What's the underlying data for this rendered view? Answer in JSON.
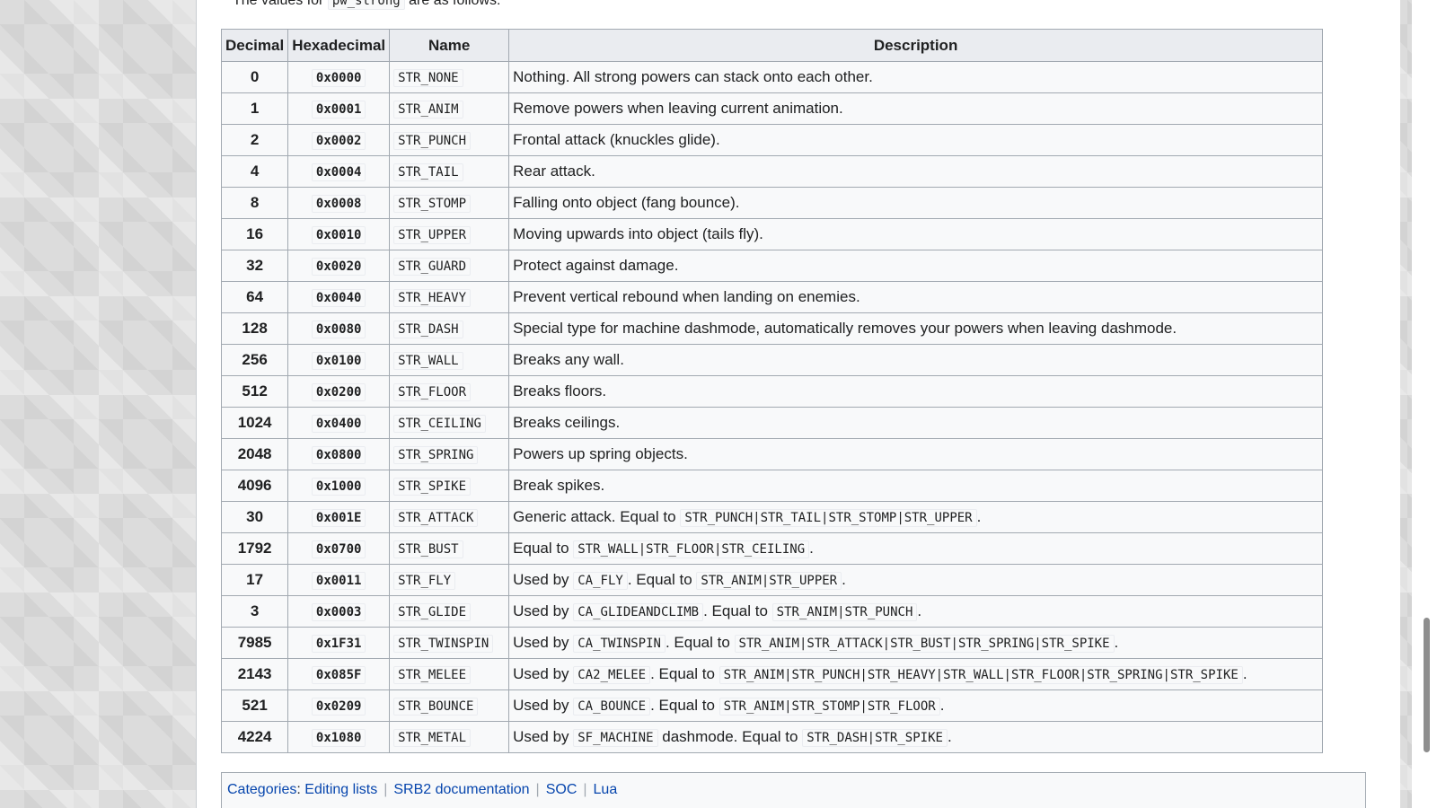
{
  "intro": {
    "before": "The values for ",
    "code": "pw_strong",
    "after": " are as follows:"
  },
  "table": {
    "headers": [
      "Decimal",
      "Hexadecimal",
      "Name",
      "Description"
    ],
    "rows": [
      {
        "dec": "0",
        "hex": "0x0000",
        "name": "STR_NONE",
        "desc": [
          "Nothing. All strong powers can stack onto each other."
        ]
      },
      {
        "dec": "1",
        "hex": "0x0001",
        "name": "STR_ANIM",
        "desc": [
          "Remove powers when leaving current animation."
        ]
      },
      {
        "dec": "2",
        "hex": "0x0002",
        "name": "STR_PUNCH",
        "desc": [
          "Frontal attack (knuckles glide)."
        ]
      },
      {
        "dec": "4",
        "hex": "0x0004",
        "name": "STR_TAIL",
        "desc": [
          "Rear attack."
        ]
      },
      {
        "dec": "8",
        "hex": "0x0008",
        "name": "STR_STOMP",
        "desc": [
          "Falling onto object (fang bounce)."
        ]
      },
      {
        "dec": "16",
        "hex": "0x0010",
        "name": "STR_UPPER",
        "desc": [
          "Moving upwards into object (tails fly)."
        ]
      },
      {
        "dec": "32",
        "hex": "0x0020",
        "name": "STR_GUARD",
        "desc": [
          "Protect against damage."
        ]
      },
      {
        "dec": "64",
        "hex": "0x0040",
        "name": "STR_HEAVY",
        "desc": [
          "Prevent vertical rebound when landing on enemies."
        ]
      },
      {
        "dec": "128",
        "hex": "0x0080",
        "name": "STR_DASH",
        "desc": [
          "Special type for machine dashmode, automatically removes your powers when leaving dashmode."
        ]
      },
      {
        "dec": "256",
        "hex": "0x0100",
        "name": "STR_WALL",
        "desc": [
          "Breaks any wall."
        ]
      },
      {
        "dec": "512",
        "hex": "0x0200",
        "name": "STR_FLOOR",
        "desc": [
          "Breaks floors."
        ]
      },
      {
        "dec": "1024",
        "hex": "0x0400",
        "name": "STR_CEILING",
        "desc": [
          "Breaks ceilings."
        ]
      },
      {
        "dec": "2048",
        "hex": "0x0800",
        "name": "STR_SPRING",
        "desc": [
          "Powers up spring objects."
        ]
      },
      {
        "dec": "4096",
        "hex": "0x1000",
        "name": "STR_SPIKE",
        "desc": [
          "Break spikes."
        ]
      },
      {
        "dec": "30",
        "hex": "0x001E",
        "name": "STR_ATTACK",
        "desc": [
          "Generic attack. Equal to ",
          {
            "code": "STR_PUNCH|STR_TAIL|STR_STOMP|STR_UPPER"
          },
          "."
        ]
      },
      {
        "dec": "1792",
        "hex": "0x0700",
        "name": "STR_BUST",
        "desc": [
          "Equal to ",
          {
            "code": "STR_WALL|STR_FLOOR|STR_CEILING"
          },
          "."
        ]
      },
      {
        "dec": "17",
        "hex": "0x0011",
        "name": "STR_FLY",
        "desc": [
          "Used by ",
          {
            "code": "CA_FLY"
          },
          ". Equal to ",
          {
            "code": "STR_ANIM|STR_UPPER"
          },
          "."
        ]
      },
      {
        "dec": "3",
        "hex": "0x0003",
        "name": "STR_GLIDE",
        "desc": [
          "Used by ",
          {
            "code": "CA_GLIDEANDCLIMB"
          },
          ". Equal to ",
          {
            "code": "STR_ANIM|STR_PUNCH"
          },
          "."
        ]
      },
      {
        "dec": "7985",
        "hex": "0x1F31",
        "name": "STR_TWINSPIN",
        "desc": [
          "Used by ",
          {
            "code": "CA_TWINSPIN"
          },
          ". Equal to ",
          {
            "code": "STR_ANIM|STR_ATTACK|STR_BUST|STR_SPRING|STR_SPIKE"
          },
          "."
        ]
      },
      {
        "dec": "2143",
        "hex": "0x085F",
        "name": "STR_MELEE",
        "desc": [
          "Used by ",
          {
            "code": "CA2_MELEE"
          },
          ". Equal to ",
          {
            "code": "STR_ANIM|STR_PUNCH|STR_HEAVY|STR_WALL|STR_FLOOR|STR_SPRING|STR_SPIKE"
          },
          "."
        ]
      },
      {
        "dec": "521",
        "hex": "0x0209",
        "name": "STR_BOUNCE",
        "desc": [
          "Used by ",
          {
            "code": "CA_BOUNCE"
          },
          ". Equal to ",
          {
            "code": "STR_ANIM|STR_STOMP|STR_FLOOR"
          },
          "."
        ]
      },
      {
        "dec": "4224",
        "hex": "0x1080",
        "name": "STR_METAL",
        "desc": [
          "Used by ",
          {
            "code": "SF_MACHINE"
          },
          " dashmode. Equal to ",
          {
            "code": "STR_DASH|STR_SPIKE"
          },
          "."
        ]
      }
    ]
  },
  "categories": {
    "label": "Categories",
    "items": [
      "Editing lists",
      "SRB2 documentation",
      "SOC",
      "Lua"
    ]
  },
  "colors": {
    "link": "#0645ad",
    "header_bg": "#eaecf0",
    "border": "#a2a9b1"
  }
}
